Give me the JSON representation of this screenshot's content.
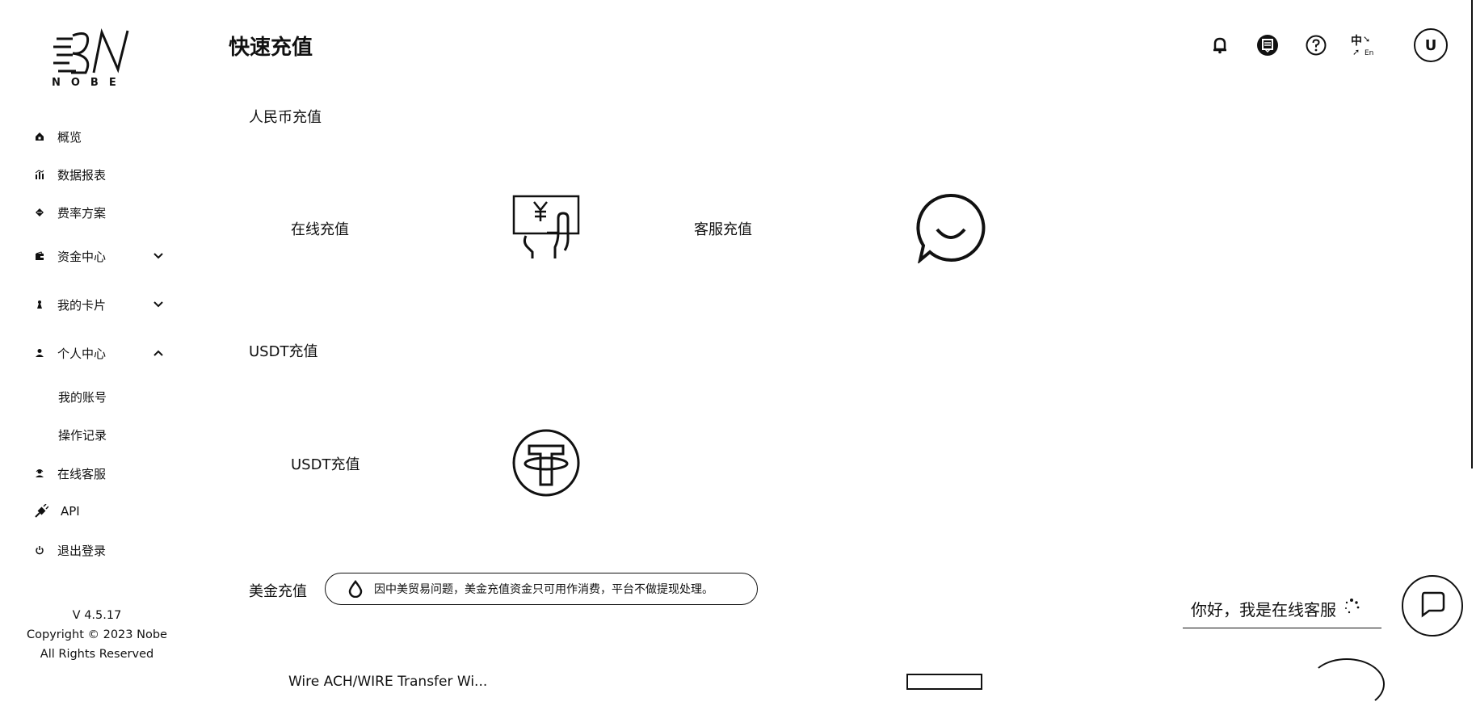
{
  "brand": {
    "logo_text": "NOBE"
  },
  "sidebar": {
    "items": [
      {
        "label": "概览",
        "icon": "home-icon"
      },
      {
        "label": "数据报表",
        "icon": "chart-icon"
      },
      {
        "label": "费率方案",
        "icon": "diamond-icon"
      },
      {
        "label": "资金中心",
        "icon": "wallet-icon",
        "chevron": "down"
      },
      {
        "label": "我的卡片",
        "icon": "card-icon",
        "chevron": "down"
      },
      {
        "label": "个人中心",
        "icon": "user-icon",
        "chevron": "up"
      },
      {
        "label": "在线客服",
        "icon": "support-icon"
      },
      {
        "label": "API",
        "icon": "plug-icon"
      },
      {
        "label": "退出登录",
        "icon": "power-icon"
      }
    ],
    "sub_items": [
      "我的账号",
      "操作记录"
    ],
    "footer": {
      "version": "V 4.5.17",
      "copyright": "Copyright © 2023 Nobe",
      "rights": "All Rights Reserved"
    }
  },
  "header": {
    "title": "快速充值",
    "lang": {
      "zh": "中",
      "en": "En"
    },
    "avatar_glyph": "U"
  },
  "sections": {
    "rmb": {
      "title": "人民币充值",
      "cards": [
        {
          "label": "在线充值",
          "icon": "cash-hand-icon"
        },
        {
          "label": "客服充值",
          "icon": "chat-bubble-icon"
        }
      ]
    },
    "usdt": {
      "title": "USDT充值",
      "cards": [
        {
          "label": "USDT充值",
          "icon": "tether-icon"
        }
      ]
    },
    "usd": {
      "title": "美金充值",
      "notice": "因中美贸易问题，美金充值资金只可用作消费，平台不做提现处理。",
      "partial_text": "Wire ACH/WIRE Transfer Wi..."
    }
  },
  "chat": {
    "greeting": "你好，我是在线客服"
  }
}
